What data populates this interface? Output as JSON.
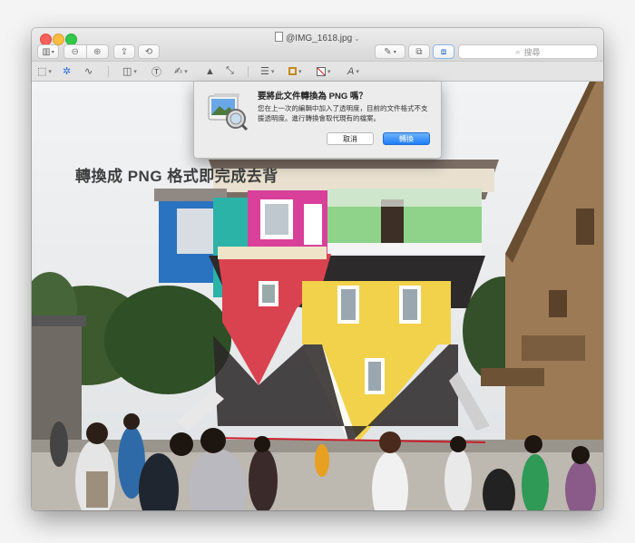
{
  "window": {
    "title": "@IMG_1618.jpg"
  },
  "toolbar": {
    "search_placeholder": "搜尋",
    "icons": [
      "sidebar-icon",
      "zoom-out-icon",
      "zoom-in-icon",
      "share-icon",
      "rotate-icon",
      "pen-icon",
      "markup-icon",
      "toolbox-icon"
    ]
  },
  "markup_bar": {
    "icons": [
      "rect-select-icon",
      "instant-alpha-icon",
      "sketch-icon",
      "shapes-icon",
      "text-icon",
      "sign-icon",
      "adjust-color-icon",
      "adjust-size-icon",
      "line-style-icon",
      "border-color-icon",
      "fill-color-icon",
      "text-style-icon"
    ]
  },
  "overlay": {
    "caption": "轉換成 PNG 格式即完成去背"
  },
  "dialog": {
    "title": "要將此文件轉換為 PNG 嗎？",
    "message": "您在上一次的編輯中加入了透明度，目前的文件格式不支援透明度。進行轉換會取代現有的檔案。",
    "cancel_label": "取消",
    "convert_label": "轉換"
  },
  "colors": {
    "accent": "#1e7ef5",
    "house_red": "#d9434f",
    "house_yellow": "#f1d24a",
    "house_blue": "#2a73c0"
  }
}
